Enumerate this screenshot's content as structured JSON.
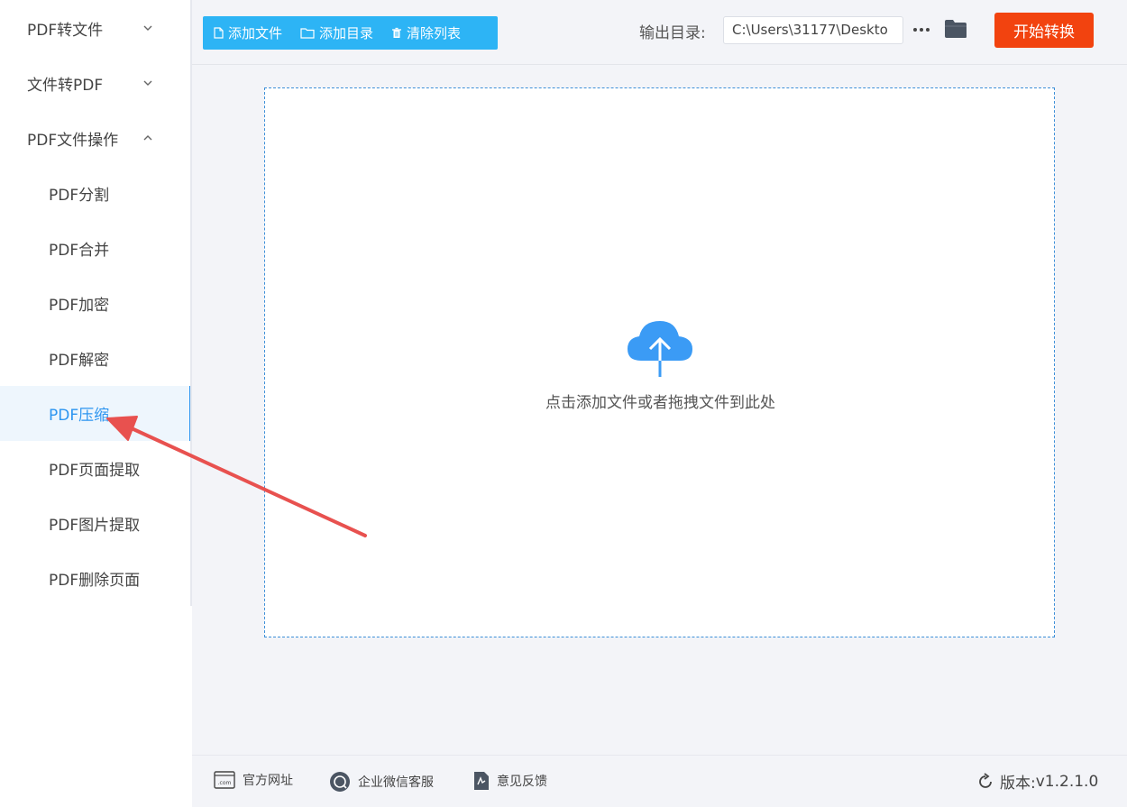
{
  "sidebar": {
    "groups": [
      {
        "label": "PDF转文件",
        "expanded": false
      },
      {
        "label": "文件转PDF",
        "expanded": false
      },
      {
        "label": "PDF文件操作",
        "expanded": true
      }
    ],
    "sub_items": [
      {
        "label": "PDF分割"
      },
      {
        "label": "PDF合并"
      },
      {
        "label": "PDF加密"
      },
      {
        "label": "PDF解密"
      },
      {
        "label": "PDF压缩",
        "active": true
      },
      {
        "label": "PDF页面提取"
      },
      {
        "label": "PDF图片提取"
      },
      {
        "label": "PDF删除页面"
      }
    ],
    "active_item": "PDF压缩"
  },
  "toolbar": {
    "add_file_label": "添加文件",
    "add_dir_label": "添加目录",
    "clear_list_label": "清除列表",
    "output_label": "输出目录:",
    "output_path": "C:\\Users\\31177\\Deskto",
    "start_label": "开始转换"
  },
  "dropzone": {
    "hint": "点击添加文件或者拖拽文件到此处",
    "icon": "cloud-upload-icon"
  },
  "footer": {
    "website_label": "官方网址",
    "wechat_label": "企业微信客服",
    "feedback_label": "意见反馈",
    "version_label": "版本:",
    "version_value": "v1.2.1.0"
  },
  "colors": {
    "accent": "#2d95f0",
    "toolbar_button": "#2db4f5",
    "start_button": "#f2430f",
    "annotation_arrow": "#e8514f"
  }
}
